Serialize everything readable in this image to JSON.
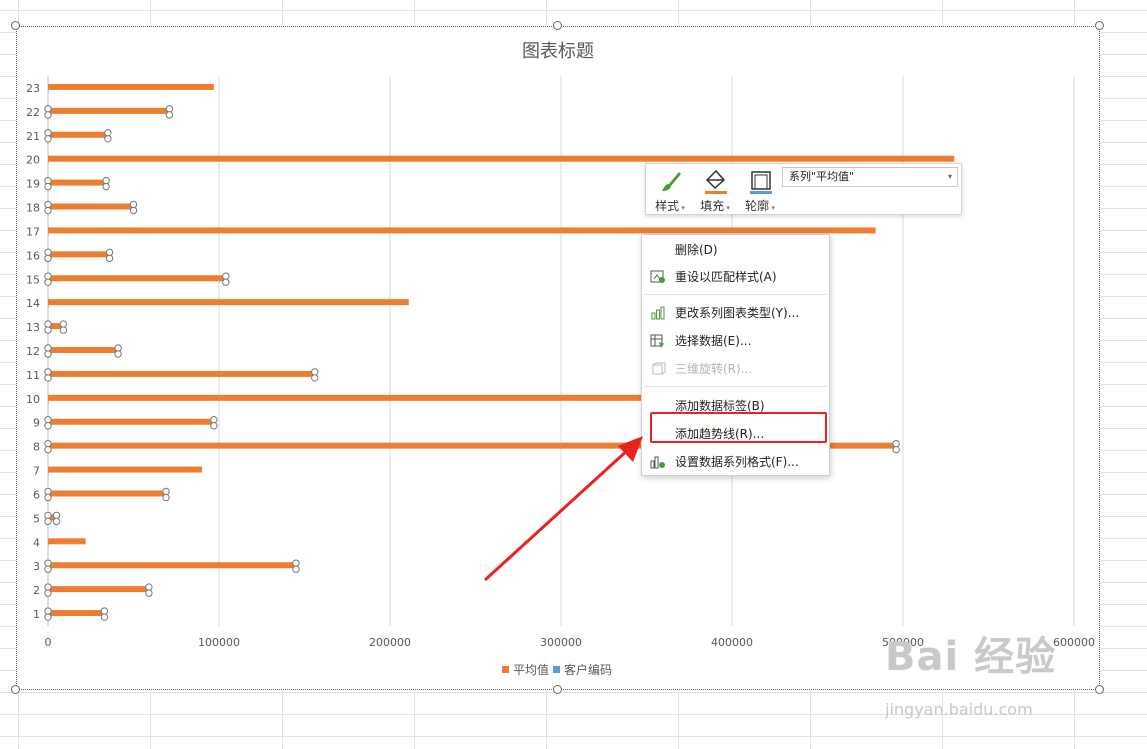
{
  "chart_data": {
    "type": "bar",
    "orientation": "horizontal",
    "title": "图表标题",
    "categories": [
      "1",
      "2",
      "3",
      "4",
      "5",
      "6",
      "7",
      "8",
      "9",
      "10",
      "11",
      "12",
      "13",
      "14",
      "15",
      "16",
      "17",
      "18",
      "19",
      "20",
      "21",
      "22",
      "23"
    ],
    "series": [
      {
        "name": "平均值",
        "color": "#ed7d31",
        "values": [
          33000,
          59000,
          145000,
          22000,
          5000,
          69000,
          90000,
          496000,
          97000,
          350000,
          156000,
          41000,
          9000,
          211000,
          104000,
          36000,
          484000,
          50000,
          34000,
          530000,
          35000,
          71000,
          97000
        ]
      },
      {
        "name": "客户编码",
        "color": "#5b9bd5",
        "values": [
          1,
          2,
          3,
          4,
          5,
          6,
          7,
          8,
          9,
          10,
          11,
          12,
          13,
          14,
          15,
          16,
          17,
          18,
          19,
          20,
          21,
          22,
          23
        ]
      }
    ],
    "selected_series": "平均值",
    "x_ticks": [
      "0",
      "100000",
      "200000",
      "300000",
      "400000",
      "500000",
      "600000"
    ],
    "xlim": [
      0,
      600000
    ],
    "grid": "vertical",
    "legend_position": "bottom"
  },
  "mini_toolbar": {
    "style_label": "样式",
    "fill_label": "填充",
    "outline_label": "轮廓",
    "series_select_value": "系列\"平均值\"",
    "fill_color": "#ed7d31",
    "outline_color": "#5b9bd5"
  },
  "context_menu": {
    "items": [
      {
        "label": "删除(D)",
        "icon": "none"
      },
      {
        "label": "重设以匹配样式(A)",
        "icon": "reset-style-icon"
      },
      {
        "label": "更改系列图表类型(Y)...",
        "icon": "bar-chart-icon"
      },
      {
        "label": "选择数据(E)...",
        "icon": "select-data-icon"
      },
      {
        "label": "三维旋转(R)...",
        "icon": "rotate-3d-icon",
        "disabled": true
      },
      {
        "label": "添加数据标签(B)",
        "icon": "none"
      },
      {
        "label": "添加趋势线(R)...",
        "icon": "none",
        "highlighted": true
      },
      {
        "label": "设置数据系列格式(F)...",
        "icon": "format-series-icon"
      }
    ]
  },
  "annotation": {
    "highlight_color": "#e8231e"
  },
  "watermark": {
    "text": "Bai 经验",
    "url": "jingyan.baidu.com"
  }
}
